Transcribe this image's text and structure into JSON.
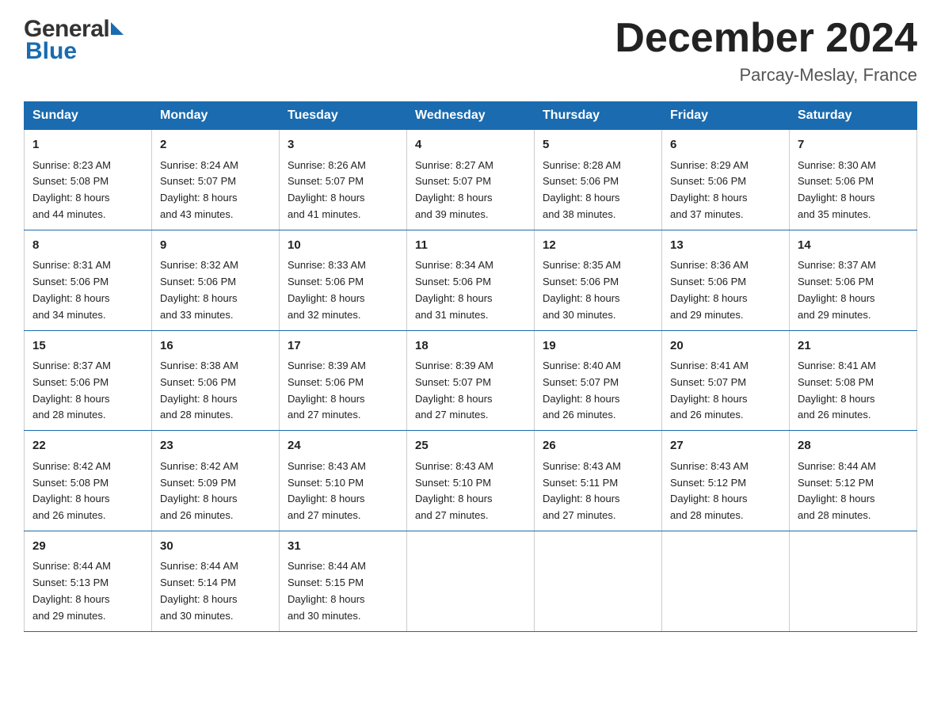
{
  "header": {
    "logo_line1": "General",
    "logo_line2": "Blue",
    "month_title": "December 2024",
    "location": "Parcay-Meslay, France"
  },
  "days_of_week": [
    "Sunday",
    "Monday",
    "Tuesday",
    "Wednesday",
    "Thursday",
    "Friday",
    "Saturday"
  ],
  "weeks": [
    [
      {
        "day": "1",
        "sunrise": "8:23 AM",
        "sunset": "5:08 PM",
        "daylight": "8 hours and 44 minutes."
      },
      {
        "day": "2",
        "sunrise": "8:24 AM",
        "sunset": "5:07 PM",
        "daylight": "8 hours and 43 minutes."
      },
      {
        "day": "3",
        "sunrise": "8:26 AM",
        "sunset": "5:07 PM",
        "daylight": "8 hours and 41 minutes."
      },
      {
        "day": "4",
        "sunrise": "8:27 AM",
        "sunset": "5:07 PM",
        "daylight": "8 hours and 39 minutes."
      },
      {
        "day": "5",
        "sunrise": "8:28 AM",
        "sunset": "5:06 PM",
        "daylight": "8 hours and 38 minutes."
      },
      {
        "day": "6",
        "sunrise": "8:29 AM",
        "sunset": "5:06 PM",
        "daylight": "8 hours and 37 minutes."
      },
      {
        "day": "7",
        "sunrise": "8:30 AM",
        "sunset": "5:06 PM",
        "daylight": "8 hours and 35 minutes."
      }
    ],
    [
      {
        "day": "8",
        "sunrise": "8:31 AM",
        "sunset": "5:06 PM",
        "daylight": "8 hours and 34 minutes."
      },
      {
        "day": "9",
        "sunrise": "8:32 AM",
        "sunset": "5:06 PM",
        "daylight": "8 hours and 33 minutes."
      },
      {
        "day": "10",
        "sunrise": "8:33 AM",
        "sunset": "5:06 PM",
        "daylight": "8 hours and 32 minutes."
      },
      {
        "day": "11",
        "sunrise": "8:34 AM",
        "sunset": "5:06 PM",
        "daylight": "8 hours and 31 minutes."
      },
      {
        "day": "12",
        "sunrise": "8:35 AM",
        "sunset": "5:06 PM",
        "daylight": "8 hours and 30 minutes."
      },
      {
        "day": "13",
        "sunrise": "8:36 AM",
        "sunset": "5:06 PM",
        "daylight": "8 hours and 29 minutes."
      },
      {
        "day": "14",
        "sunrise": "8:37 AM",
        "sunset": "5:06 PM",
        "daylight": "8 hours and 29 minutes."
      }
    ],
    [
      {
        "day": "15",
        "sunrise": "8:37 AM",
        "sunset": "5:06 PM",
        "daylight": "8 hours and 28 minutes."
      },
      {
        "day": "16",
        "sunrise": "8:38 AM",
        "sunset": "5:06 PM",
        "daylight": "8 hours and 28 minutes."
      },
      {
        "day": "17",
        "sunrise": "8:39 AM",
        "sunset": "5:06 PM",
        "daylight": "8 hours and 27 minutes."
      },
      {
        "day": "18",
        "sunrise": "8:39 AM",
        "sunset": "5:07 PM",
        "daylight": "8 hours and 27 minutes."
      },
      {
        "day": "19",
        "sunrise": "8:40 AM",
        "sunset": "5:07 PM",
        "daylight": "8 hours and 26 minutes."
      },
      {
        "day": "20",
        "sunrise": "8:41 AM",
        "sunset": "5:07 PM",
        "daylight": "8 hours and 26 minutes."
      },
      {
        "day": "21",
        "sunrise": "8:41 AM",
        "sunset": "5:08 PM",
        "daylight": "8 hours and 26 minutes."
      }
    ],
    [
      {
        "day": "22",
        "sunrise": "8:42 AM",
        "sunset": "5:08 PM",
        "daylight": "8 hours and 26 minutes."
      },
      {
        "day": "23",
        "sunrise": "8:42 AM",
        "sunset": "5:09 PM",
        "daylight": "8 hours and 26 minutes."
      },
      {
        "day": "24",
        "sunrise": "8:43 AM",
        "sunset": "5:10 PM",
        "daylight": "8 hours and 27 minutes."
      },
      {
        "day": "25",
        "sunrise": "8:43 AM",
        "sunset": "5:10 PM",
        "daylight": "8 hours and 27 minutes."
      },
      {
        "day": "26",
        "sunrise": "8:43 AM",
        "sunset": "5:11 PM",
        "daylight": "8 hours and 27 minutes."
      },
      {
        "day": "27",
        "sunrise": "8:43 AM",
        "sunset": "5:12 PM",
        "daylight": "8 hours and 28 minutes."
      },
      {
        "day": "28",
        "sunrise": "8:44 AM",
        "sunset": "5:12 PM",
        "daylight": "8 hours and 28 minutes."
      }
    ],
    [
      {
        "day": "29",
        "sunrise": "8:44 AM",
        "sunset": "5:13 PM",
        "daylight": "8 hours and 29 minutes."
      },
      {
        "day": "30",
        "sunrise": "8:44 AM",
        "sunset": "5:14 PM",
        "daylight": "8 hours and 30 minutes."
      },
      {
        "day": "31",
        "sunrise": "8:44 AM",
        "sunset": "5:15 PM",
        "daylight": "8 hours and 30 minutes."
      },
      null,
      null,
      null,
      null
    ]
  ]
}
